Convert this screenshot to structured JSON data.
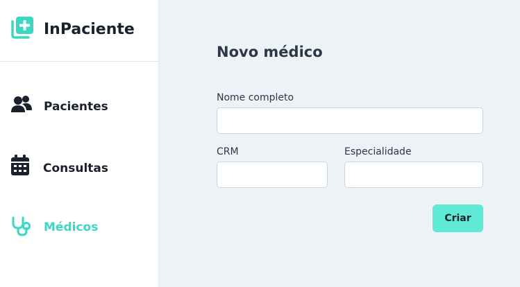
{
  "app": {
    "name": "InPaciente",
    "accent_color": "#38d9c0",
    "logo_icon": "doctor-cross-icon"
  },
  "sidebar": {
    "items": [
      {
        "label": "Pacientes",
        "icon": "users-icon",
        "active": false
      },
      {
        "label": "Consultas",
        "icon": "calendar-icon",
        "active": false
      },
      {
        "label": "Médicos",
        "icon": "stethoscope-icon",
        "active": true
      }
    ]
  },
  "form": {
    "title": "Novo médico",
    "fields": {
      "full_name": {
        "label": "Nome completo",
        "value": ""
      },
      "crm": {
        "label": "CRM",
        "value": ""
      },
      "specialty": {
        "label": "Especialidade",
        "value": ""
      }
    },
    "submit_label": "Criar"
  }
}
